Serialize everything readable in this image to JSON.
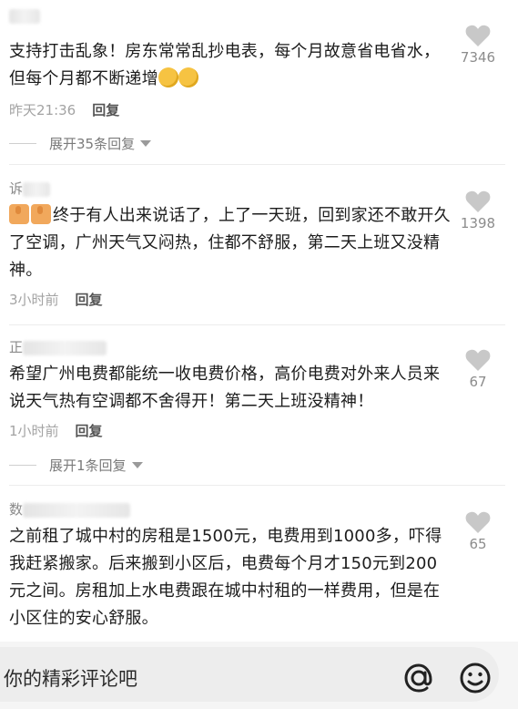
{
  "comments": [
    {
      "username": "",
      "text": "支持打击乱象！房东常常乱抄电表，每个月故意省电省水，但每个月都不断递增",
      "time": "昨天21:36",
      "reply_label": "回复",
      "likes": "7346",
      "expand": "展开35条回复"
    },
    {
      "username": "诉",
      "text": "终于有人出来说话了，上了一天班，回到家还不敢开久了空调，广州天气又闷热，住都不舒服，第二天上班又没精神。",
      "time": "3小时前",
      "reply_label": "回复",
      "likes": "1398"
    },
    {
      "username": "正",
      "text": "希望广州电费都能统一收电费价格，高价电费对外来人员来说天气热有空调都不舍得开！第二天上班没精神！",
      "time": "1小时前",
      "reply_label": "回复",
      "likes": "67",
      "expand": "展开1条回复"
    },
    {
      "username": "数",
      "text": "之前租了城中村的房租是1500元，电费用到1000多，吓得我赶紧搬家。后来搬到小区后，电费每个月才150元到200元之间。房租加上水电费跟在城中村租的一样费用，但是在小区住的安心舒服。",
      "likes": "65"
    }
  ],
  "input": {
    "placeholder": "你的精彩评论吧"
  },
  "icons": {
    "like": "heart-icon",
    "at": "at-icon",
    "emoji": "smile-icon"
  },
  "colors": {
    "heart": "#c8c8c8",
    "meta": "#a3a3a3"
  }
}
